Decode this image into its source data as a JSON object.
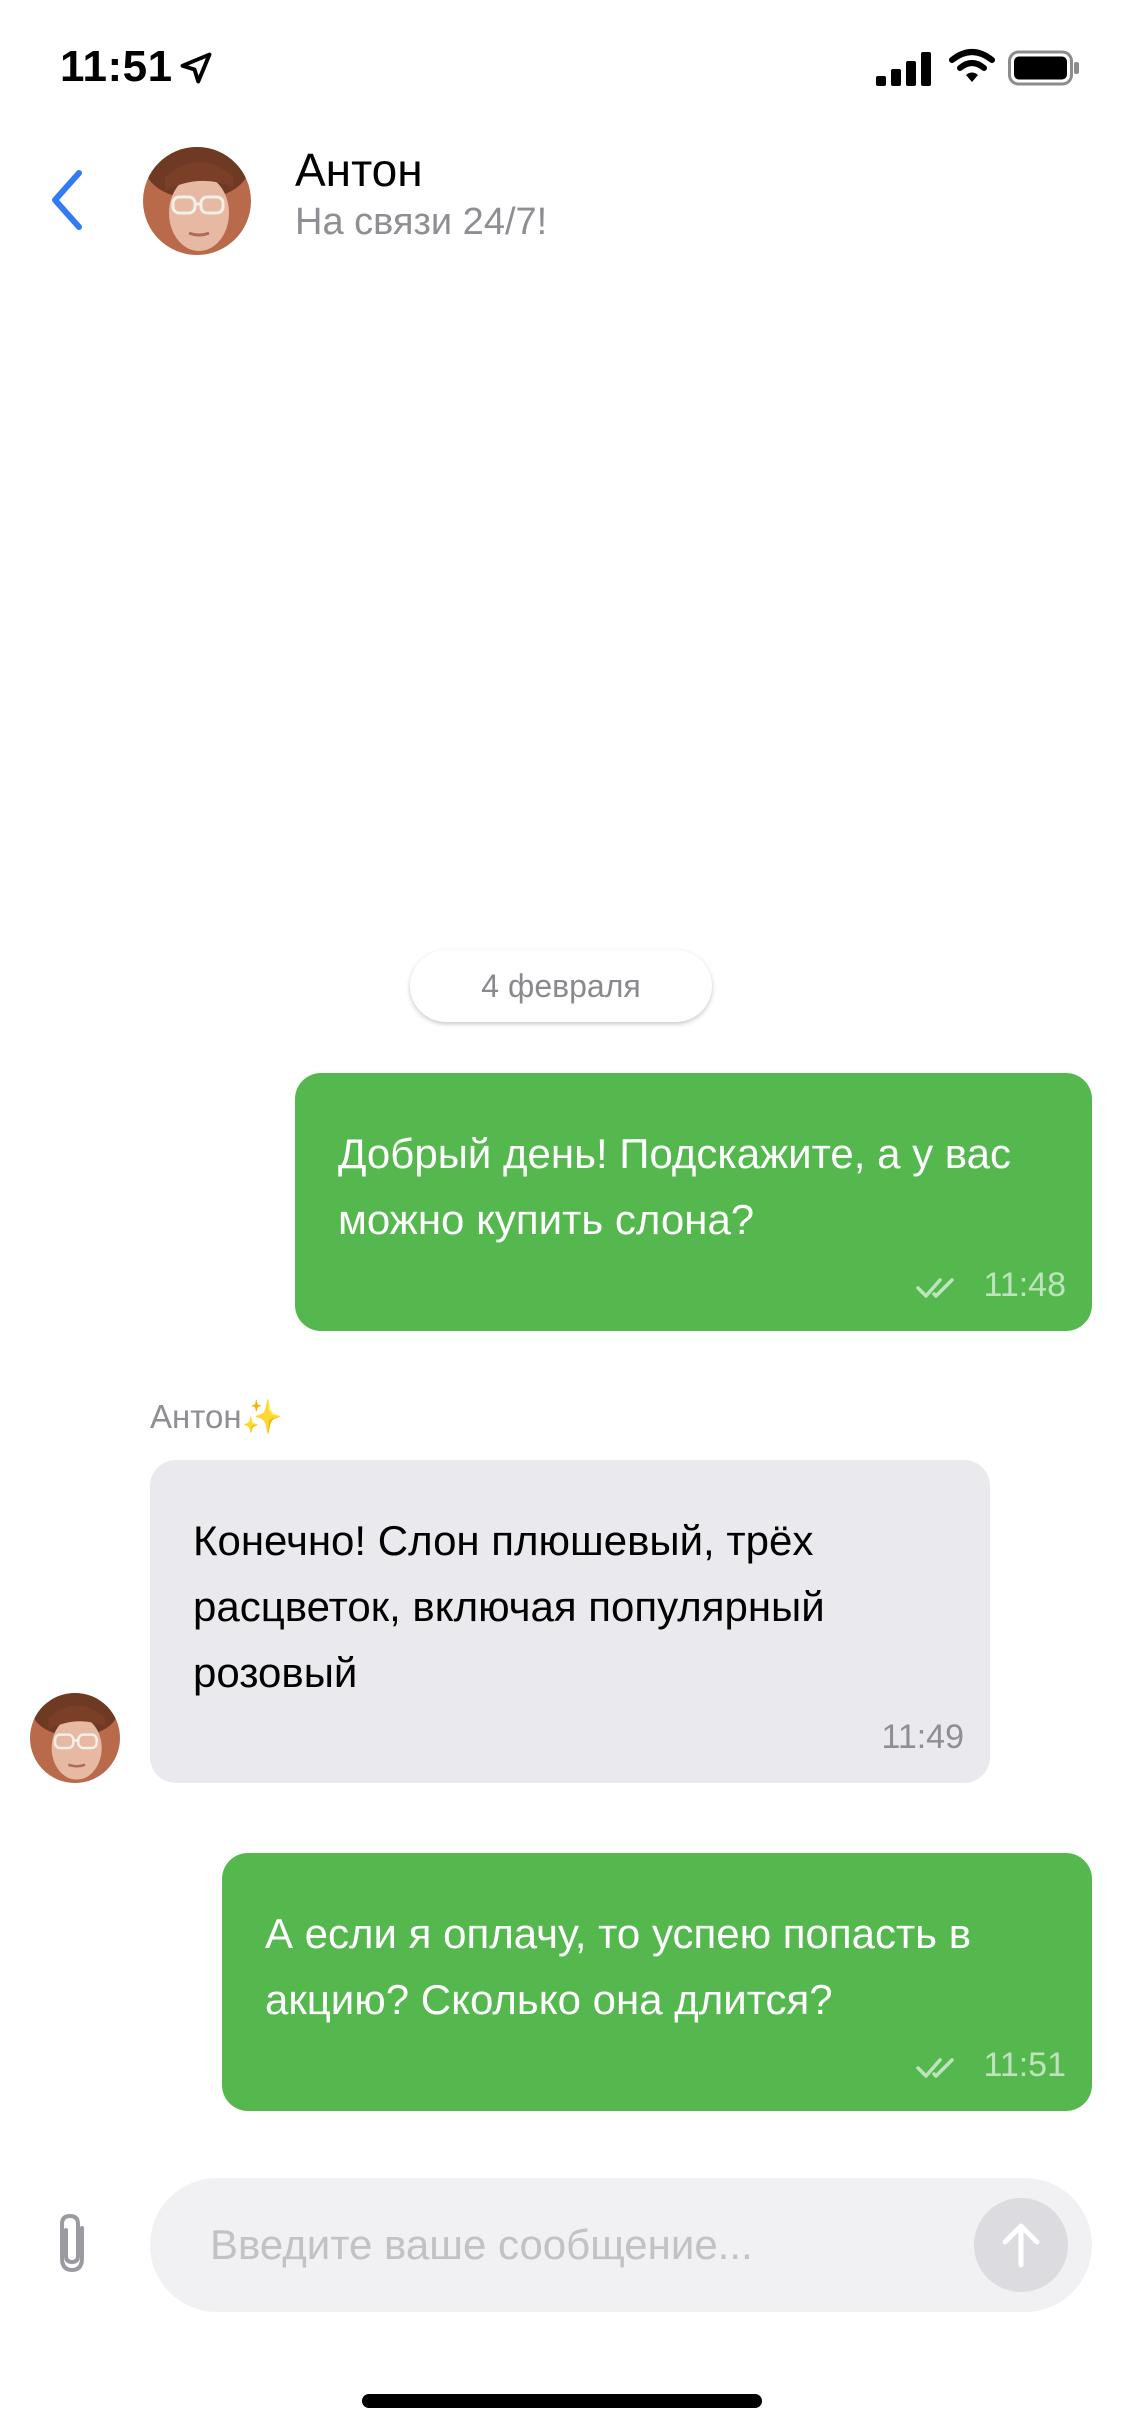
{
  "status_bar": {
    "time": "11:51",
    "icons": [
      "location-arrow-icon",
      "cellular-signal-icon",
      "wifi-icon",
      "battery-icon"
    ]
  },
  "header": {
    "back_icon": "chevron-left-icon",
    "contact_name": "Антон",
    "contact_status": "На связи 24/7!"
  },
  "chat": {
    "date_separator": "4 февраля",
    "messages": [
      {
        "direction": "outgoing",
        "text": "Добрый день! Подскажите, а у вас можно купить слона?",
        "time": "11:48",
        "read_icon": "double-check-icon"
      },
      {
        "direction": "incoming",
        "sender": "Антон✨",
        "text": "Конечно! Слон плюшевый, трёх расцветок, включая популярный розовый",
        "time": "11:49"
      },
      {
        "direction": "outgoing",
        "text": "А если я оплачу, то успею попасть в акцию? Сколько она длится?",
        "time": "11:51",
        "read_icon": "double-check-icon"
      }
    ]
  },
  "composer": {
    "attach_icon": "paperclip-icon",
    "placeholder": "Введите ваше сообщение...",
    "value": "",
    "send_icon": "arrow-up-icon"
  },
  "colors": {
    "accent_blue": "#2f7cf6",
    "outgoing_bubble": "#54b84f",
    "incoming_bubble": "#e9e9ee",
    "secondary_text": "#8e8e93"
  }
}
